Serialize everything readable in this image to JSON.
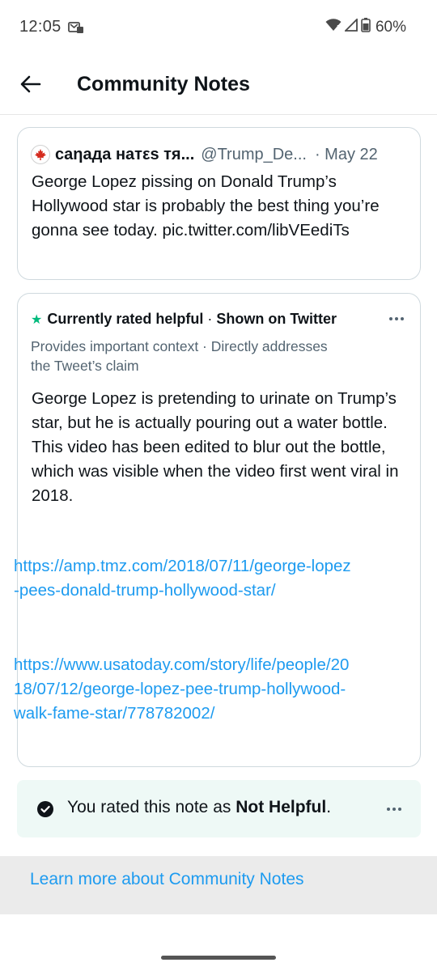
{
  "status_bar": {
    "time": "12:05",
    "battery": "60%"
  },
  "app_bar": {
    "title": "Community Notes"
  },
  "tweet": {
    "author_name": "caηaдa нaтεs тя...",
    "author_handle": "@Trump_De...",
    "date": "· May 22",
    "text": "George Lopez pissing on Donald Trump’s Hollywood star is probably the best thing you’re gonna see today. pic.twitter.com/libVEediTs"
  },
  "note": {
    "status_rating": "Currently rated helpful",
    "status_sep": "·",
    "status_shown": "Shown on Twitter",
    "reasons": "Provides important context · Directly addresses the Tweet’s claim",
    "body": "George Lopez is pretending to urinate on Trump’s star, but he is actually pouring out a water bottle.  This video has been edited to blur out the bottle, which was visible when the video first went viral in 2018.",
    "links": [
      "https://amp.tmz.com/2018/07/11/george-lopez-pees-donald-trump-hollywood-star/",
      "https://www.usatoday.com/story/life/people/2018/07/12/george-lopez-pee-trump-hollywood-walk-fame-star/778782002/"
    ]
  },
  "rating": {
    "prefix": "You rated this note as ",
    "value": "Not Helpful",
    "suffix": "."
  },
  "footer": {
    "learn_more": "Learn more about Community Notes"
  },
  "colors": {
    "accent": "#1d9bf0",
    "helpful_star": "#00ba7c",
    "rated_banner_bg": "#eef9f6",
    "footer_bg": "#ebebeb"
  }
}
